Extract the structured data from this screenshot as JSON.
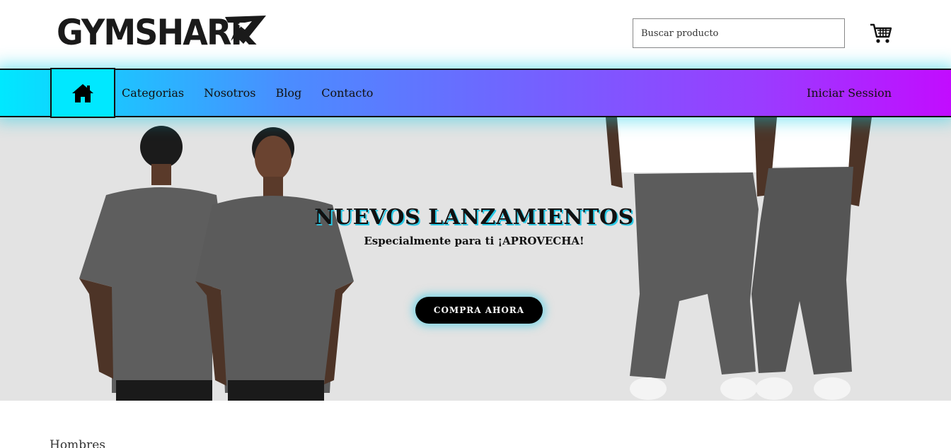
{
  "header": {
    "logo_text": "GYMSHARK",
    "search_placeholder": "Buscar producto",
    "cart_icon": "shopping-cart-icon"
  },
  "nav": {
    "home_icon": "home-icon",
    "links": [
      "Categorias",
      "Nosotros",
      "Blog",
      "Contacto"
    ],
    "login_label": "Iniciar Session",
    "gradient_colors": [
      "#00e8ff",
      "#c20cff"
    ]
  },
  "hero": {
    "title": "NUEVOS LANZAMIENTOS",
    "subtitle": "Especialmente para ti ¡APROVECHA!",
    "cta_label": "COMPRA AHORA",
    "background_color": "#e3e3e3"
  },
  "section": {
    "title": "Hombres"
  }
}
